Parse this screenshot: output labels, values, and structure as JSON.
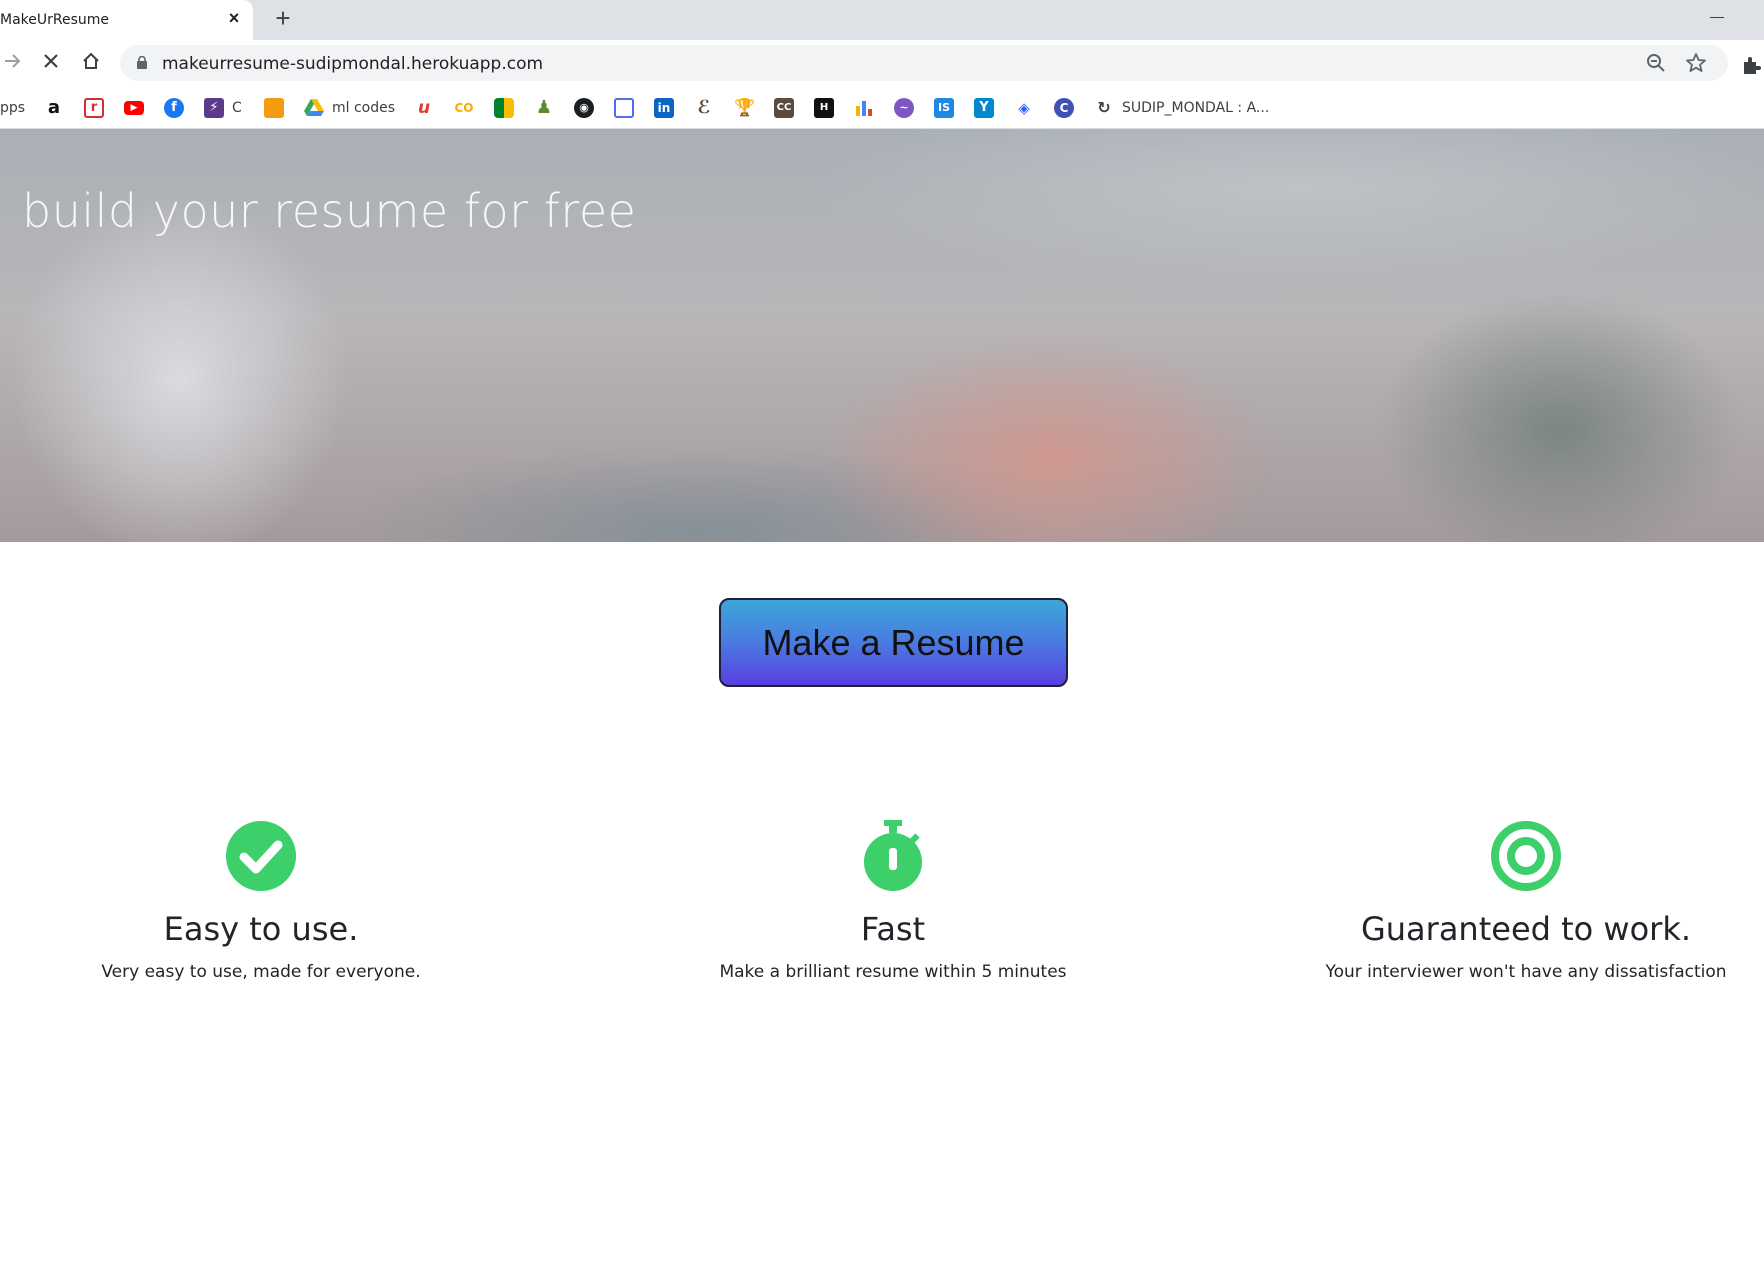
{
  "browser": {
    "tab_title": "MakeUrResume",
    "tab_close_glyph": "×",
    "new_tab_glyph": "+",
    "url": "makeurresume-sudipmondal.herokuapp.com"
  },
  "bookmarks": {
    "apps_label": "pps",
    "items": [
      {
        "icon": "amazon-icon",
        "label": ""
      },
      {
        "icon": "r-icon",
        "label": ""
      },
      {
        "icon": "youtube-icon",
        "label": ""
      },
      {
        "icon": "facebook-icon",
        "label": ""
      },
      {
        "icon": "bolt-icon",
        "label": "C"
      },
      {
        "icon": "book-icon",
        "label": ""
      },
      {
        "icon": "google-drive-icon",
        "label": "ml codes"
      },
      {
        "icon": "u-icon",
        "label": ""
      },
      {
        "icon": "co-icon",
        "label": ""
      },
      {
        "icon": "meet-icon",
        "label": ""
      },
      {
        "icon": "chess-icon",
        "label": ""
      },
      {
        "icon": "github-icon",
        "label": ""
      },
      {
        "icon": "calendar-icon",
        "label": ""
      },
      {
        "icon": "linkedin-icon",
        "label": ""
      },
      {
        "icon": "codechef-icon",
        "label": ""
      },
      {
        "icon": "trophy-icon",
        "label": ""
      },
      {
        "icon": "cc-icon",
        "label": ""
      },
      {
        "icon": "hackerrank-icon",
        "label": ""
      },
      {
        "icon": "chart-icon",
        "label": ""
      },
      {
        "icon": "wave-icon",
        "label": ""
      },
      {
        "icon": "is-icon",
        "label": ""
      },
      {
        "icon": "y-icon",
        "label": ""
      },
      {
        "icon": "diamond-icon",
        "label": ""
      },
      {
        "icon": "c-circle-icon",
        "label": ""
      },
      {
        "icon": "leetcode-icon",
        "label": "SUDIP_MONDAL : A..."
      }
    ]
  },
  "hero": {
    "tagline": "build your resume for free"
  },
  "cta": {
    "label": "Make a Resume"
  },
  "features": [
    {
      "icon": "check-circle-icon",
      "title": "Easy to use.",
      "desc": "Very easy to use, made for everyone."
    },
    {
      "icon": "stopwatch-icon",
      "title": "Fast",
      "desc": "Make a brilliant resume within 5 minutes"
    },
    {
      "icon": "target-icon",
      "title": "Guaranteed to work.",
      "desc": "Your interviewer won't have any dissatisfaction"
    }
  ],
  "colors": {
    "accent_green": "#3ccf6a",
    "cta_top": "#3aa7d8",
    "cta_bottom": "#5a3ee0"
  }
}
